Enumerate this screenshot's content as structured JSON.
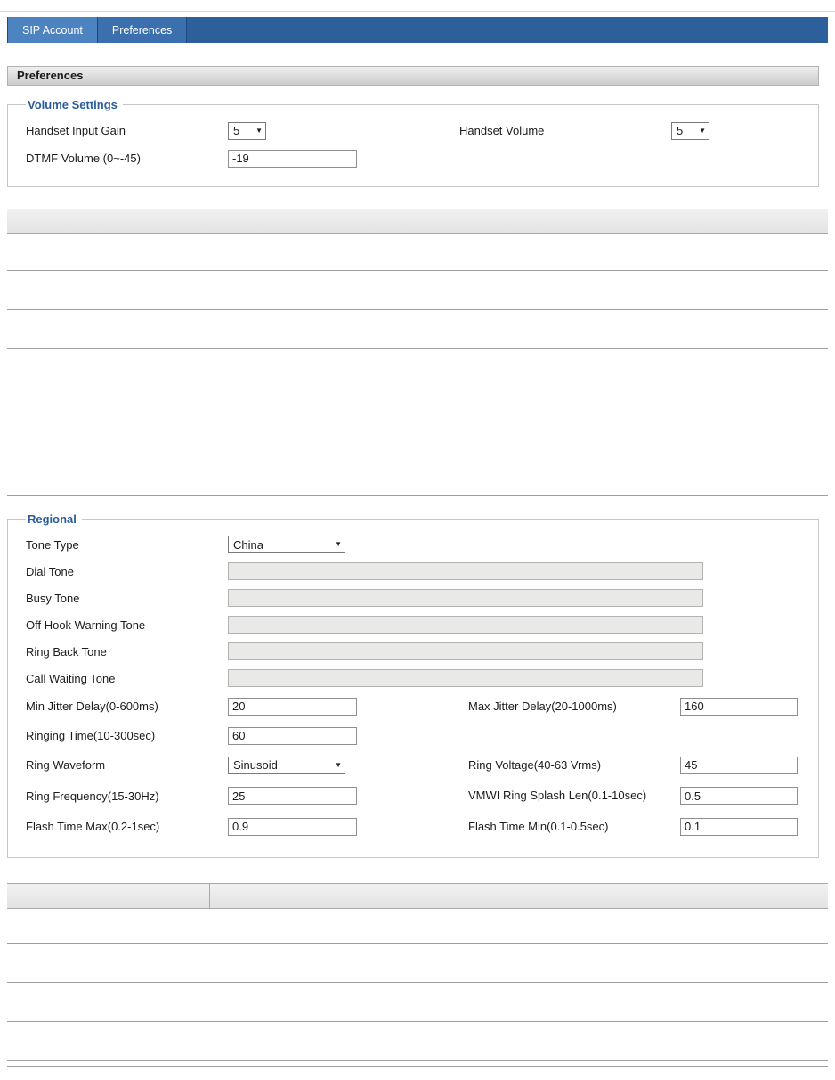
{
  "ui": {
    "dropdown_arrow": "▼"
  },
  "tabs": {
    "sip_account": "SIP Account",
    "preferences": "Preferences"
  },
  "header": {
    "title": "Preferences"
  },
  "volume": {
    "legend": "Volume Settings",
    "handset_input_gain_label": "Handset Input Gain",
    "handset_input_gain_value": "5",
    "handset_volume_label": "Handset Volume",
    "handset_volume_value": "5",
    "dtmf_volume_label": "DTMF Volume (0~-45)",
    "dtmf_volume_value": "-19"
  },
  "regional": {
    "legend": "Regional",
    "tone_type_label": "Tone Type",
    "tone_type_value": "China",
    "dial_tone_label": "Dial Tone",
    "dial_tone_value": "",
    "busy_tone_label": "Busy Tone",
    "busy_tone_value": "",
    "off_hook_warning_tone_label": "Off Hook Warning Tone",
    "off_hook_warning_tone_value": "",
    "ring_back_tone_label": "Ring Back Tone",
    "ring_back_tone_value": "",
    "call_waiting_tone_label": "Call Waiting Tone",
    "call_waiting_tone_value": "",
    "min_jitter_delay_label": "Min Jitter Delay(0-600ms)",
    "min_jitter_delay_value": "20",
    "max_jitter_delay_label": "Max Jitter Delay(20-1000ms)",
    "max_jitter_delay_value": "160",
    "ringing_time_label": "Ringing Time(10-300sec)",
    "ringing_time_value": "60",
    "ring_waveform_label": "Ring Waveform",
    "ring_waveform_value": "Sinusoid",
    "ring_voltage_label": "Ring Voltage(40-63 Vrms)",
    "ring_voltage_value": "45",
    "ring_frequency_label": "Ring Frequency(15-30Hz)",
    "ring_frequency_value": "25",
    "vmwi_ring_splash_len_label": "VMWI Ring Splash Len(0.1-10sec)",
    "vmwi_ring_splash_len_value": "0.5",
    "flash_time_max_label": "Flash Time Max(0.2-1sec)",
    "flash_time_max_value": "0.9",
    "flash_time_min_label": "Flash Time Min(0.1-0.5sec)",
    "flash_time_min_value": "0.1"
  },
  "colors": {
    "nav_bar": "#2d5f9a",
    "active_tab": "#4d83c0",
    "legend_text": "#2b5c9c"
  }
}
